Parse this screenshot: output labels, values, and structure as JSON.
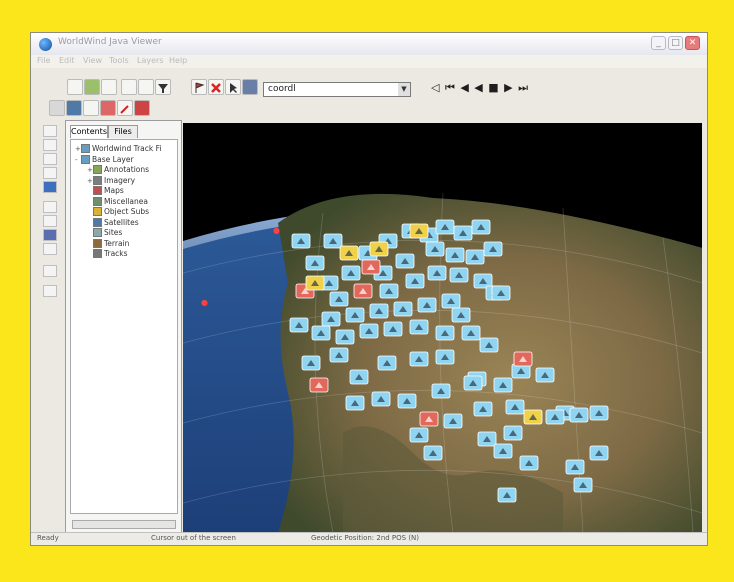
{
  "window": {
    "title": "WorldWind Java Viewer",
    "minimize_glyph": "_",
    "maximize_glyph": "□",
    "close_glyph": "✕"
  },
  "menu": [
    "File",
    "Edit",
    "View",
    "Tools",
    "Layers",
    "Help"
  ],
  "toolbar": {
    "search_value": "coordl",
    "media_controls": "◁ ⏮ ◀ ◀ ■ ▶ ⏭"
  },
  "panel": {
    "tabs": [
      "Contents",
      "Files"
    ],
    "tree": [
      {
        "label": "Worldwind Track Fi",
        "indent": 0,
        "expand": "+",
        "color": "#6a9cc0"
      },
      {
        "label": "Base Layer",
        "indent": 0,
        "expand": "-",
        "color": "#6a9cc0"
      },
      {
        "label": "Annotations",
        "indent": 1,
        "expand": "+",
        "color": "#87a65a"
      },
      {
        "label": "Imagery",
        "indent": 1,
        "expand": "+",
        "color": "#7d7d7d"
      },
      {
        "label": "Maps",
        "indent": 1,
        "expand": "",
        "color": "#c05050"
      },
      {
        "label": "Miscellanea",
        "indent": 1,
        "expand": "",
        "color": "#6f8f6f"
      },
      {
        "label": "Object Subs",
        "indent": 1,
        "expand": "",
        "color": "#d9b23c"
      },
      {
        "label": "Satellites",
        "indent": 1,
        "expand": "",
        "color": "#4f7aa8"
      },
      {
        "label": "Sites",
        "indent": 1,
        "expand": "",
        "color": "#8aa"
      },
      {
        "label": "Terrain",
        "indent": 1,
        "expand": "",
        "color": "#8b6a3f"
      },
      {
        "label": "Tracks",
        "indent": 1,
        "expand": "",
        "color": "#777"
      }
    ]
  },
  "status": {
    "left": "Ready",
    "middle": "Cursor out of the screen",
    "right": "Geodetic Position: 2nd POS (N)"
  },
  "colors": {
    "frame": "#fbe61c",
    "marker_blue": "#8fd4f0",
    "marker_red": "#e3685c",
    "marker_yellow": "#f0d24a"
  }
}
